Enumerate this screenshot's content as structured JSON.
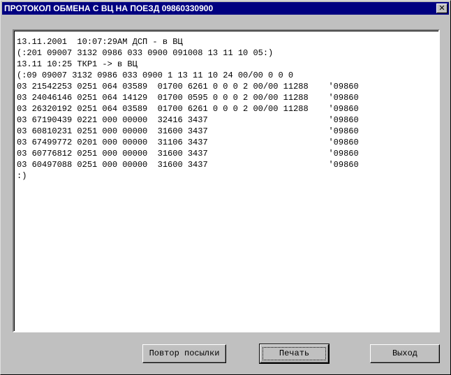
{
  "window": {
    "title": "ПРОТОКОЛ ОБМЕНА С ВЦ НА ПОЕЗД 09860330900",
    "close_label": "✕"
  },
  "log": {
    "lines": [
      "13.11.2001  10:07:29AM ДСП - в ВЦ",
      "(:201 09007 3132 0986 033 0900 091008 13 11 10 05:)",
      "13.11 10:25 ТКР1 -> в ВЦ",
      "(:09 09007 3132 0986 033 0900 1 13 11 10 24 00/00 0 0 0",
      "03 21542253 0251 064 03589  01700 6261 0 0 0 2 00/00 11288    '09860",
      "03 24046146 0251 064 14129  01700 0595 0 0 0 2 00/00 11288    '09860",
      "03 26320192 0251 064 03589  01700 6261 0 0 0 2 00/00 11288    '09860",
      "03 67190439 0221 000 00000  32416 3437                        '09860",
      "03 60810231 0251 000 00000  31600 3437                        '09860",
      "03 67499772 0201 000 00000  31106 3437                        '09860",
      "03 60776812 0251 000 00000  31600 3437                        '09860",
      "03 60497088 0251 000 00000  31600 3437                        '09860",
      ":)"
    ]
  },
  "buttons": {
    "resend_label": "Повтор посылки",
    "print_label": "Печать",
    "exit_label": "Выход"
  }
}
